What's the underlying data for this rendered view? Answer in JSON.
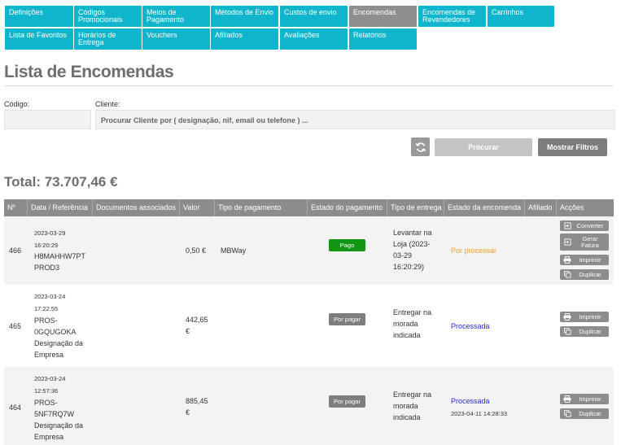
{
  "tabs": [
    {
      "label": "Definições"
    },
    {
      "label": "Códigos Promocionais"
    },
    {
      "label": "Meios de Pagamento"
    },
    {
      "label": "Métodos de Envio"
    },
    {
      "label": "Custos de envio"
    },
    {
      "label": "Encomendas"
    },
    {
      "label": "Encomendas de Revendedores"
    },
    {
      "label": "Carrinhos"
    },
    {
      "label": "Lista de Favoritos"
    },
    {
      "label": "Horários de Entrega"
    },
    {
      "label": "Vouchers"
    },
    {
      "label": "Afiliados"
    },
    {
      "label": "Avaliações"
    },
    {
      "label": "Relatórios"
    }
  ],
  "active_tab": "Encomendas",
  "page_title": "Lista de Encomendas",
  "filters": {
    "code_label": "Código:",
    "code_value": "",
    "client_label": "Cliente:",
    "client_placeholder": "Procurar Cliente por ( designação, nif, email ou telefone ) ...",
    "search_button": "Procurar",
    "filters_button": "Mostrar Filtros"
  },
  "total": "Total: 73.707,46 €",
  "table": {
    "headers": [
      "Nº",
      "Data / Referência",
      "Documentos associados",
      "Valor",
      "Tipo de pagamento",
      "Estado do pagamento",
      "Tipo de entrega",
      "Estado da encomenda",
      "Afiliado",
      "Acções"
    ],
    "rows": [
      {
        "number": "466",
        "date": "2023-03-29",
        "time": "16:20:29",
        "ref1": "H8MAHHW7PT",
        "ref2": "PROD3",
        "ref3": "",
        "documents": "",
        "value1": "0,50 €",
        "value2": "",
        "payment_type": "MBWay",
        "payment_status": "Pago",
        "delivery1": "Levantar na",
        "delivery2": "Loja (2023-",
        "delivery3": "03-29",
        "delivery4": "16:20:29)",
        "order_status": "Por processar",
        "order_status_color": "#f0a030",
        "order_status_date": "",
        "affiliate": "",
        "actions": [
          "Converter",
          "Gerar Fatura",
          "Imprimir",
          "Duplicar"
        ]
      },
      {
        "number": "465",
        "date": "2023-03-24",
        "time": "17:22:55",
        "ref1": "PROS-",
        "ref2": "0GQUGOKA",
        "ref3": "Designação da",
        "ref4": "Empresa",
        "documents": "",
        "value1": "442,65",
        "value2": "€",
        "payment_type": "",
        "payment_status": "Por pagar",
        "delivery1": "Entregar na",
        "delivery2": "morada",
        "delivery3": "indicada",
        "order_status": "Processada",
        "order_status_color": "#2a2ad0",
        "order_status_date": "",
        "affiliate": "",
        "actions": [
          "Imprimir",
          "Duplicar"
        ]
      },
      {
        "number": "464",
        "date": "2023-03-24",
        "time": "12:57:36",
        "ref1": "PROS-",
        "ref2": "5NF7RQ7W",
        "ref3": "Designação da",
        "ref4": "Empresa",
        "documents": "",
        "value1": "885,45",
        "value2": "€",
        "payment_type": "",
        "payment_status": "Por pagar",
        "delivery1": "Entregar na",
        "delivery2": "morada",
        "delivery3": "indicada",
        "order_status": "Processada",
        "order_status_color": "#2a2ad0",
        "order_status_date": "2023-04-11 14:28:33",
        "affiliate": "",
        "actions": [
          "Imprimir",
          "Duplicar"
        ]
      }
    ]
  },
  "icons": {
    "refresh": "refresh-icon",
    "convert": "login-arrow-icon",
    "invoice": "login-arrow-icon",
    "print": "printer-icon",
    "duplicate": "copy-icon"
  },
  "colors": {
    "tab": "#0fb5cd",
    "tab_active": "#8e8e8e",
    "paid": "#129512",
    "unpaid": "#7d7d7d"
  }
}
